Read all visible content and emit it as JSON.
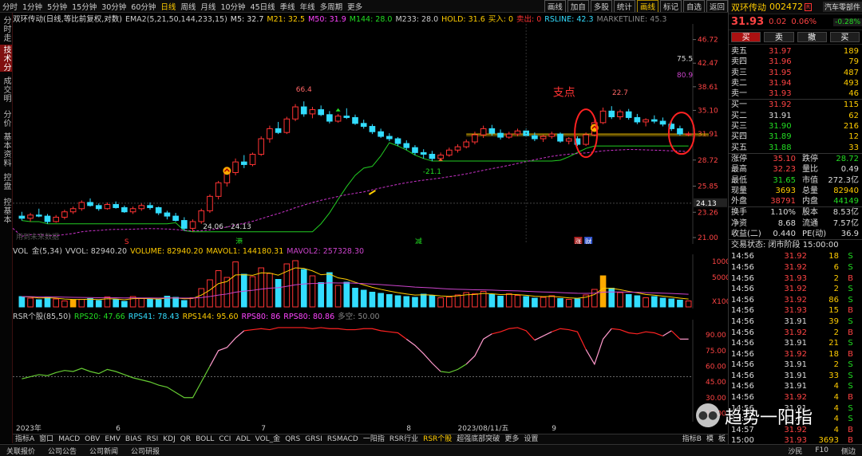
{
  "topbar": {
    "periods": [
      "分时",
      "1分钟",
      "5分钟",
      "15分钟",
      "30分钟",
      "60分钟",
      "日线",
      "周线",
      "月线",
      "10分钟",
      "45日线",
      "季线",
      "年线",
      "多周期",
      "更多"
    ],
    "active_period": "日线",
    "tools": [
      "画线",
      "加自",
      "多股",
      "统计",
      "画线",
      "标记",
      "自选",
      "返回"
    ],
    "active_tool": "画线"
  },
  "left_nav": [
    "分时走势",
    "技术分析",
    "成交明细",
    "分价表",
    "基本资料",
    "控盘",
    "控基本"
  ],
  "main_panel": {
    "title": "双环传动(日线,等比前复权,对数)",
    "indicators": [
      {
        "label": "EMA2(5,21,50,144,233,15)",
        "color": "#cccccc"
      },
      {
        "label": "M5: 32.7",
        "color": "#dddddd"
      },
      {
        "label": "M21: 32.5",
        "color": "#ffcc00"
      },
      {
        "label": "M50: 31.9",
        "color": "#ff44ff"
      },
      {
        "label": "M144: 28.0",
        "color": "#22dd22"
      },
      {
        "label": "M233: 28.0",
        "color": "#cccccc"
      },
      {
        "label": "HOLD: 31.6",
        "color": "#ffcc00"
      },
      {
        "label": "买入: 0",
        "color": "#ffcc00"
      },
      {
        "label": "卖出: 0",
        "color": "#ff3333"
      },
      {
        "label": "RSLINE: 42.3",
        "color": "#33ddff"
      },
      {
        "label": "MARKETLINE: 45.3",
        "color": "#888888"
      }
    ],
    "annotations": {
      "peak1": "66.4",
      "peak2": "22.7",
      "low1": "-21.1",
      "range": "24.06 - 24.13",
      "v755": "75.5",
      "v809": "80.9",
      "support": "支点",
      "event_s": "S",
      "event_gang": "港",
      "event_jian": "减",
      "event_zhang": "涨",
      "event_cai": "财",
      "watermark": "用到未来数据",
      "flag": "大",
      "cursor_price": "24.13"
    },
    "price_labels": [
      "46.72",
      "42.47",
      "38.61",
      "35.10",
      "31.91",
      "28.72",
      "25.85",
      "23.26",
      "21.00"
    ]
  },
  "vol_panel": {
    "indicators": [
      {
        "label": "VOL_金(5,34)",
        "color": "#cccccc"
      },
      {
        "label": "VVOL: 82940.20",
        "color": "#cccccc"
      },
      {
        "label": "VOLUME: 82940.20",
        "color": "#ffcc00"
      },
      {
        "label": "MAVOL1: 144180.31",
        "color": "#ffcc00"
      },
      {
        "label": "MAVOL2: 257328.30",
        "color": "#cc44cc"
      }
    ],
    "axis": [
      "10000",
      "5000",
      "X100"
    ]
  },
  "rsr_panel": {
    "indicators": [
      {
        "label": "RSR个股(85,50)",
        "color": "#cccccc"
      },
      {
        "label": "RPS20: 47.66",
        "color": "#22dd22"
      },
      {
        "label": "RPS41: 78.43",
        "color": "#33ddff"
      },
      {
        "label": "RPS144: 95.60",
        "color": "#ffcc00"
      },
      {
        "label": "RPS80: 86",
        "color": "#ff44ff"
      },
      {
        "label": "RPS80: 80.86",
        "color": "#ff44ff"
      },
      {
        "label": "多空: 50.00",
        "color": "#888888"
      }
    ],
    "axis": [
      "90.00",
      "75.00",
      "60.00",
      "45.00",
      "30.00",
      "15.00"
    ]
  },
  "time_axis": {
    "labels": [
      "2023年",
      "6",
      "7",
      "8",
      "2023/08/11/五",
      "9"
    ]
  },
  "bottombar": {
    "tabs": [
      "指标A",
      "窗口",
      "MACD",
      "OBV",
      "EMV",
      "BIAS",
      "RSI",
      "KDJ",
      "QR",
      "BOLL",
      "CCI",
      "ADL",
      "VOL_金",
      "QRS",
      "GRSI",
      "RSMACD",
      "一阳指",
      "RSR行业",
      "RSR个股",
      "超强底部突破",
      "更多",
      "设置"
    ],
    "active": "RSR个股",
    "right": [
      "指标B",
      "模",
      "板"
    ]
  },
  "statusbar": {
    "items": [
      "关联报价",
      "公司公告",
      "公司新闻",
      "公司研报"
    ],
    "right": [
      "沙民",
      "F10",
      "侧边"
    ]
  },
  "stock": {
    "name": "双环传动",
    "code": "002472",
    "tag": "R",
    "sector": "汽车零部件",
    "price": "31.93",
    "change": "0.02",
    "change_pct": "0.06%",
    "sector_pct": "-0.28%"
  },
  "trade_buttons": [
    "买",
    "卖",
    "撤",
    "买"
  ],
  "sell_book": [
    [
      "卖五",
      "31.97",
      "189"
    ],
    [
      "卖四",
      "31.96",
      "79"
    ],
    [
      "卖三",
      "31.95",
      "487"
    ],
    [
      "卖二",
      "31.94",
      "493"
    ],
    [
      "卖一",
      "31.93",
      "46"
    ]
  ],
  "buy_book": [
    [
      "买一",
      "31.92",
      "115"
    ],
    [
      "买二",
      "31.91",
      "62"
    ],
    [
      "买三",
      "31.90",
      "216"
    ],
    [
      "买四",
      "31.89",
      "12"
    ],
    [
      "买五",
      "31.88",
      "33"
    ]
  ],
  "stats": [
    [
      "涨停",
      "35.10",
      "跌停",
      "28.72"
    ],
    [
      "最高",
      "32.23",
      "量比",
      "0.49"
    ],
    [
      "最低",
      "31.65",
      "市值",
      "272.3亿"
    ],
    [
      "现量",
      "3693",
      "总量",
      "82940"
    ],
    [
      "外盘",
      "38791",
      "内盘",
      "44149"
    ]
  ],
  "stats2": [
    [
      "换手",
      "1.10%",
      "股本",
      "8.53亿"
    ],
    [
      "净资",
      "8.68",
      "流通",
      "7.57亿"
    ],
    [
      "收益(二)",
      "0.440",
      "PE(动)",
      "36.9"
    ]
  ],
  "trade_status": "交易状态: 闭市阶段 15:00:00",
  "ticks": [
    [
      "14:56",
      "31.92",
      "18",
      "S"
    ],
    [
      "14:56",
      "31.92",
      "6",
      "S"
    ],
    [
      "14:56",
      "31.93",
      "2",
      "B"
    ],
    [
      "14:56",
      "31.92",
      "2",
      "S"
    ],
    [
      "14:56",
      "31.92",
      "86",
      "S"
    ],
    [
      "14:56",
      "31.93",
      "15",
      "B"
    ],
    [
      "14:56",
      "31.91",
      "39",
      "S"
    ],
    [
      "14:56",
      "31.92",
      "2",
      "B"
    ],
    [
      "14:56",
      "31.91",
      "21",
      "S"
    ],
    [
      "14:56",
      "31.92",
      "18",
      "B"
    ],
    [
      "14:56",
      "31.91",
      "2",
      "S"
    ],
    [
      "14:56",
      "31.91",
      "33",
      "S"
    ],
    [
      "14:56",
      "31.91",
      "4",
      "S"
    ],
    [
      "14:56",
      "31.92",
      "4",
      "B"
    ],
    [
      "14:56",
      "31.91",
      "4",
      "S"
    ],
    [
      "14:56",
      "31.91",
      "4",
      "S"
    ],
    [
      "14:57",
      "31.92",
      "4",
      "B"
    ],
    [
      "15:00",
      "31.93",
      "3693",
      "B"
    ]
  ],
  "watermark": "趋势一阳指",
  "chart_data": {
    "type": "candlestick",
    "title": "双环传动(日线,等比前复权,对数)",
    "yscale": "log",
    "ylim": [
      21.0,
      48.5
    ],
    "ohlc": [
      [
        22.9,
        23.3,
        22.5,
        22.7
      ],
      [
        22.7,
        23.2,
        22.4,
        23.0
      ],
      [
        23.0,
        23.6,
        22.8,
        22.9
      ],
      [
        22.9,
        23.1,
        22.2,
        22.4
      ],
      [
        22.4,
        23.0,
        22.3,
        22.8
      ],
      [
        22.8,
        23.5,
        22.6,
        23.3
      ],
      [
        23.3,
        23.8,
        23.1,
        23.6
      ],
      [
        23.6,
        24.4,
        23.4,
        24.2
      ],
      [
        24.2,
        24.6,
        23.8,
        23.9
      ],
      [
        23.9,
        24.1,
        23.4,
        23.6
      ],
      [
        23.6,
        24.2,
        23.5,
        24.0
      ],
      [
        24.0,
        24.3,
        23.6,
        23.7
      ],
      [
        23.7,
        23.9,
        23.2,
        23.3
      ],
      [
        23.3,
        23.8,
        23.1,
        23.6
      ],
      [
        23.6,
        24.1,
        23.4,
        23.9
      ],
      [
        23.9,
        24.2,
        23.5,
        23.7
      ],
      [
        23.7,
        23.8,
        23.0,
        23.2
      ],
      [
        23.2,
        23.4,
        22.6,
        22.9
      ],
      [
        22.9,
        23.2,
        22.4,
        22.5
      ],
      [
        22.5,
        22.8,
        21.6,
        21.8
      ],
      [
        21.8,
        22.6,
        21.5,
        22.4
      ],
      [
        22.4,
        23.6,
        22.2,
        23.4
      ],
      [
        23.4,
        25.0,
        23.2,
        24.8
      ],
      [
        24.8,
        26.4,
        24.5,
        26.2
      ],
      [
        26.2,
        27.6,
        25.8,
        27.3
      ],
      [
        27.3,
        28.9,
        27.0,
        28.5
      ],
      [
        28.5,
        29.3,
        27.8,
        28.2
      ],
      [
        28.2,
        29.6,
        28.0,
        29.4
      ],
      [
        29.4,
        31.6,
        29.2,
        31.3
      ],
      [
        31.3,
        33.0,
        30.8,
        32.6
      ],
      [
        32.6,
        33.5,
        31.9,
        32.1
      ],
      [
        32.1,
        34.2,
        31.9,
        33.9
      ],
      [
        33.9,
        36.0,
        33.6,
        35.6
      ],
      [
        35.6,
        36.4,
        34.2,
        34.6
      ],
      [
        34.6,
        35.6,
        34.0,
        35.2
      ],
      [
        35.2,
        35.8,
        34.3,
        34.5
      ],
      [
        34.5,
        35.0,
        33.3,
        33.6
      ],
      [
        33.6,
        34.6,
        33.4,
        34.3
      ],
      [
        34.3,
        35.4,
        33.9,
        34.1
      ],
      [
        34.1,
        34.5,
        33.1,
        33.3
      ],
      [
        33.3,
        33.8,
        32.6,
        32.9
      ],
      [
        32.9,
        33.2,
        31.9,
        32.2
      ],
      [
        32.2,
        32.6,
        31.4,
        31.6
      ],
      [
        31.6,
        32.0,
        31.0,
        31.3
      ],
      [
        31.3,
        31.5,
        30.4,
        30.7
      ],
      [
        30.7,
        31.1,
        29.9,
        30.2
      ],
      [
        30.2,
        30.5,
        29.3,
        29.6
      ],
      [
        29.6,
        30.0,
        28.9,
        29.4
      ],
      [
        29.4,
        29.8,
        28.6,
        28.9
      ],
      [
        28.9,
        29.6,
        28.7,
        29.3
      ],
      [
        29.3,
        30.2,
        29.1,
        29.9
      ],
      [
        29.9,
        30.6,
        29.6,
        30.3
      ],
      [
        30.3,
        31.2,
        30.1,
        30.9
      ],
      [
        30.9,
        32.2,
        30.6,
        31.8
      ],
      [
        31.8,
        33.0,
        31.4,
        32.6
      ],
      [
        32.6,
        33.1,
        31.7,
        32.0
      ],
      [
        32.0,
        32.5,
        31.2,
        31.5
      ],
      [
        31.5,
        32.2,
        31.3,
        31.9
      ],
      [
        31.9,
        32.6,
        31.6,
        32.3
      ],
      [
        32.3,
        32.6,
        31.5,
        31.7
      ],
      [
        31.7,
        32.1,
        31.0,
        31.3
      ],
      [
        31.3,
        31.8,
        30.9,
        31.6
      ],
      [
        31.6,
        32.2,
        31.3,
        31.9
      ],
      [
        31.9,
        32.1,
        30.8,
        31.0
      ],
      [
        31.0,
        31.5,
        30.6,
        31.3
      ],
      [
        31.3,
        31.6,
        30.4,
        30.6
      ],
      [
        30.6,
        32.1,
        30.4,
        31.8
      ],
      [
        31.8,
        33.8,
        31.6,
        33.4
      ],
      [
        33.4,
        35.5,
        33.2,
        35.0
      ],
      [
        35.0,
        35.7,
        33.9,
        34.2
      ],
      [
        34.2,
        35.2,
        33.8,
        34.9
      ],
      [
        34.9,
        35.3,
        33.8,
        34.1
      ],
      [
        34.1,
        34.6,
        33.2,
        33.5
      ],
      [
        33.5,
        34.0,
        32.9,
        33.8
      ],
      [
        33.8,
        34.4,
        33.3,
        33.6
      ],
      [
        33.6,
        34.1,
        32.9,
        33.2
      ],
      [
        33.2,
        33.6,
        32.3,
        32.6
      ],
      [
        32.6,
        33.0,
        31.7,
        31.9
      ],
      [
        31.9,
        32.2,
        31.6,
        31.93
      ]
    ],
    "volume": [
      2.6,
      2.2,
      1.8,
      2.4,
      2.0,
      1.5,
      1.7,
      1.9,
      2.1,
      1.6,
      2.5,
      1.9,
      1.4,
      2.6,
      2.2,
      2.0,
      1.8,
      2.7,
      2.4,
      1.6,
      2.3,
      4.6,
      6.8,
      9.1,
      7.4,
      11.3,
      8.2,
      7.6,
      9.8,
      8.4,
      6.9,
      10.8,
      11.6,
      9.4,
      7.8,
      6.1,
      8.6,
      5.4,
      6.2,
      4.7,
      4.2,
      3.7,
      3.4,
      3.1,
      2.8,
      2.6,
      2.4,
      3.2,
      2.8,
      2.3,
      2.5,
      3.0,
      3.6,
      3.3,
      3.9,
      3.1,
      2.7,
      3.3,
      2.9,
      2.6,
      2.2,
      2.4,
      2.8,
      2.1,
      1.9,
      2.0,
      3.0,
      4.4,
      7.8,
      4.7,
      3.6,
      3.1,
      2.8,
      2.3,
      2.6,
      2.2,
      2.0,
      1.7,
      1.5
    ],
    "rps": [
      48,
      50,
      52,
      51,
      54,
      56,
      55,
      58,
      55,
      53,
      57,
      55,
      52,
      49,
      47,
      45,
      42,
      40,
      35,
      30,
      30,
      45,
      60,
      75,
      78,
      87,
      94,
      95,
      96,
      95,
      97,
      97,
      97,
      97,
      96,
      97,
      96,
      96,
      95,
      95,
      96,
      96,
      94,
      93,
      92,
      86,
      80,
      72,
      63,
      55,
      54,
      57,
      62,
      70,
      86,
      91,
      93,
      96,
      97,
      94,
      85,
      89,
      93,
      96,
      95,
      93,
      76,
      62,
      86,
      96,
      95,
      92,
      91,
      93,
      92,
      89,
      94,
      86,
      86
    ],
    "legend_series": [
      "RPS20",
      "RPS41",
      "RPS144",
      "RPS80"
    ]
  }
}
